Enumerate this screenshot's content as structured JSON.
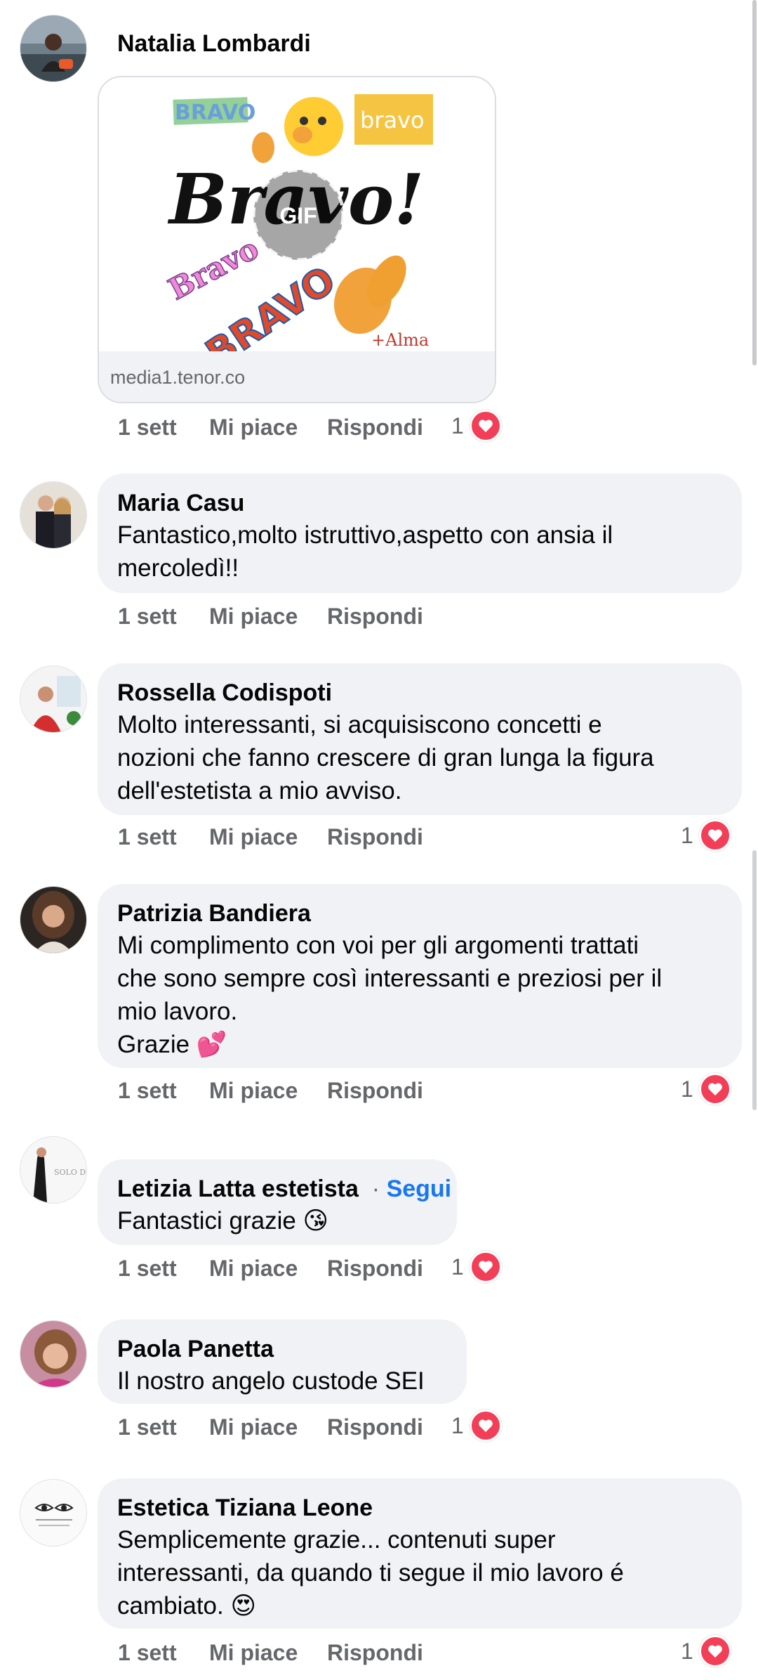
{
  "action_labels": {
    "time": "1 sett",
    "like": "Mi piace",
    "reply": "Rispondi"
  },
  "gif_comment": {
    "author": "Natalia Lombardi",
    "gif_badge": "GIF",
    "gif_source": "media1.tenor.co",
    "gif_texts": {
      "main": "Bravo!",
      "tag_left": "BRAVO",
      "tag_right": "bravo",
      "diag_small": "Bravo",
      "diag_big": "BRAVO",
      "signature": "+Alma"
    },
    "reactions": "1"
  },
  "comments": [
    {
      "author": "Maria Casu",
      "lines": [
        "Fantastico,molto istruttivo,aspetto con ansia il",
        "mercoledì!!"
      ],
      "reactions": ""
    },
    {
      "author": "Rossella Codispoti",
      "lines": [
        "Molto interessanti, si acquisiscono concetti e",
        "nozioni che fanno crescere di gran lunga la figura",
        "dell'estetista a mio avviso."
      ],
      "reactions": "1"
    },
    {
      "author": "Patrizia Bandiera",
      "lines": [
        "Mi complimento con voi per gli argomenti trattati",
        "che sono sempre così interessanti e preziosi per il",
        "mio lavoro.",
        "Grazie 💕"
      ],
      "reactions": "1"
    },
    {
      "author": "Letizia Latta estetista",
      "follow": "Segui",
      "lines": [
        "Fantastici grazie 😘"
      ],
      "reactions": "1",
      "avatar_text": "SOLO DIL"
    },
    {
      "author": "Paola Panetta",
      "lines": [
        "Il nostro angelo custode SEI"
      ],
      "reactions": "1"
    },
    {
      "author": "Estetica Tiziana Leone",
      "lines": [
        "Semplicemente grazie... contenuti super",
        "interessanti, da quando ti segue il mio lavoro é",
        "cambiato. 😍"
      ],
      "reactions": "1"
    }
  ],
  "colors": {
    "like_heart": "#f33e58",
    "follow_link": "#1877f2",
    "bubble": "#f0f2f5",
    "meta_text": "#65676b"
  }
}
